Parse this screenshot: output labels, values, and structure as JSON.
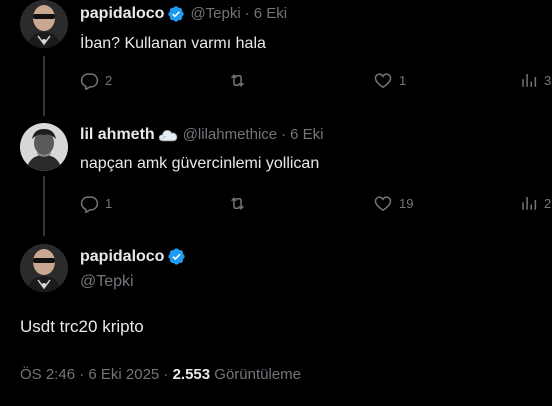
{
  "reply1": {
    "display_name": "papidaloco",
    "handle": "@Tepki",
    "separator": "·",
    "time": "6 Eki",
    "text": "İban? Kullanan varmı hala",
    "replies": "2",
    "retweets": "",
    "likes": "1",
    "views": "3"
  },
  "reply2": {
    "display_name": "lil ahmeth",
    "handle": "@lilahmethice",
    "separator": "·",
    "time": "6 Eki",
    "text": "napçan amk güvercinlemi yollican",
    "replies": "1",
    "retweets": "",
    "likes": "19",
    "views": "2"
  },
  "main_tweet": {
    "display_name": "papidaloco",
    "handle": "@Tepki",
    "text": "Usdt trc20 kripto",
    "timestamp": "ÖS 2:46 · 6 Eki 2025 · ",
    "views_count": "2.553",
    "views_label": " Görüntüleme"
  },
  "colors": {
    "background": "#000000",
    "text_primary": "#e7e9ea",
    "text_secondary": "#71767b",
    "verified_blue": "#1d9bf0",
    "thread_line": "#333639"
  },
  "icons": [
    "reply-icon",
    "retweet-icon",
    "like-icon",
    "views-icon",
    "verified-badge-icon",
    "cloud-emoji-icon"
  ]
}
